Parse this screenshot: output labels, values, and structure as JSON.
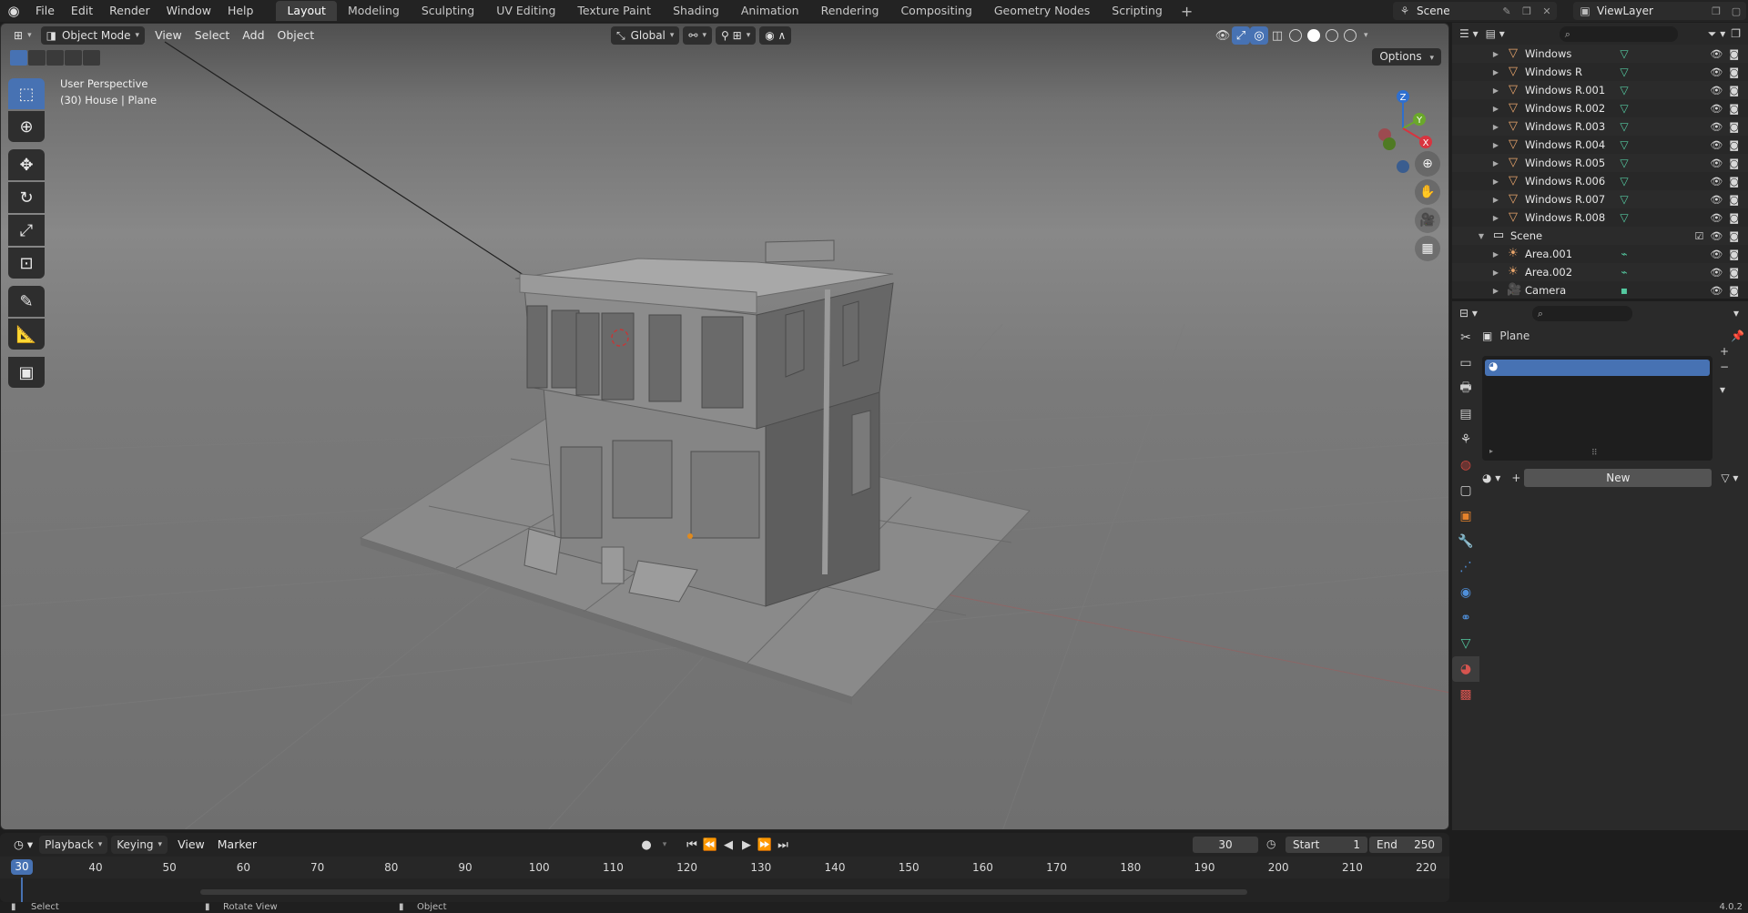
{
  "menu": {
    "items": [
      "File",
      "Edit",
      "Render",
      "Window",
      "Help"
    ]
  },
  "workspaces": [
    "Layout",
    "Modeling",
    "Sculpting",
    "UV Editing",
    "Texture Paint",
    "Shading",
    "Animation",
    "Rendering",
    "Compositing",
    "Geometry Nodes",
    "Scripting"
  ],
  "active_workspace": "Layout",
  "scene": "Scene",
  "view_layer": "ViewLayer",
  "viewport": {
    "mode": "Object Mode",
    "menus": [
      "View",
      "Select",
      "Add",
      "Object"
    ],
    "transform_orientation": "Global",
    "options_label": "Options",
    "perspective_label": "User Perspective",
    "context_label": "(30) House | Plane",
    "gizmo_axes": [
      "Z",
      "Y",
      "X"
    ]
  },
  "outliner": {
    "rows": [
      {
        "name": "Windows",
        "type": "mesh",
        "indent": 1
      },
      {
        "name": "Windows R",
        "type": "mesh",
        "indent": 1
      },
      {
        "name": "Windows R.001",
        "type": "mesh",
        "indent": 1
      },
      {
        "name": "Windows R.002",
        "type": "mesh",
        "indent": 1
      },
      {
        "name": "Windows R.003",
        "type": "mesh",
        "indent": 1
      },
      {
        "name": "Windows R.004",
        "type": "mesh",
        "indent": 1
      },
      {
        "name": "Windows R.005",
        "type": "mesh",
        "indent": 1
      },
      {
        "name": "Windows R.006",
        "type": "mesh",
        "indent": 1
      },
      {
        "name": "Windows R.007",
        "type": "mesh",
        "indent": 1
      },
      {
        "name": "Windows R.008",
        "type": "mesh",
        "indent": 1
      },
      {
        "name": "Scene",
        "type": "collection",
        "indent": 0
      },
      {
        "name": "Area.001",
        "type": "light",
        "indent": 1
      },
      {
        "name": "Area.002",
        "type": "light",
        "indent": 1
      },
      {
        "name": "Camera",
        "type": "camera",
        "indent": 1
      }
    ]
  },
  "properties": {
    "object_name": "Plane",
    "new_label": "New"
  },
  "timeline": {
    "menus": [
      "Playback",
      "Keying",
      "View",
      "Marker"
    ],
    "current_frame": "30",
    "start_label": "Start",
    "start": "1",
    "end_label": "End",
    "end": "250",
    "ticks": [
      "40",
      "50",
      "60",
      "70",
      "80",
      "90",
      "100",
      "110",
      "120",
      "130",
      "140",
      "150",
      "160",
      "170",
      "180",
      "190",
      "200",
      "210",
      "220"
    ]
  },
  "status": {
    "select": "Select",
    "rotate": "Rotate View",
    "object": "Object",
    "version": "4.0.2"
  },
  "colors": {
    "accent": "#4772b3",
    "mesh": "#54c9a0",
    "object": "#e8a56b"
  }
}
